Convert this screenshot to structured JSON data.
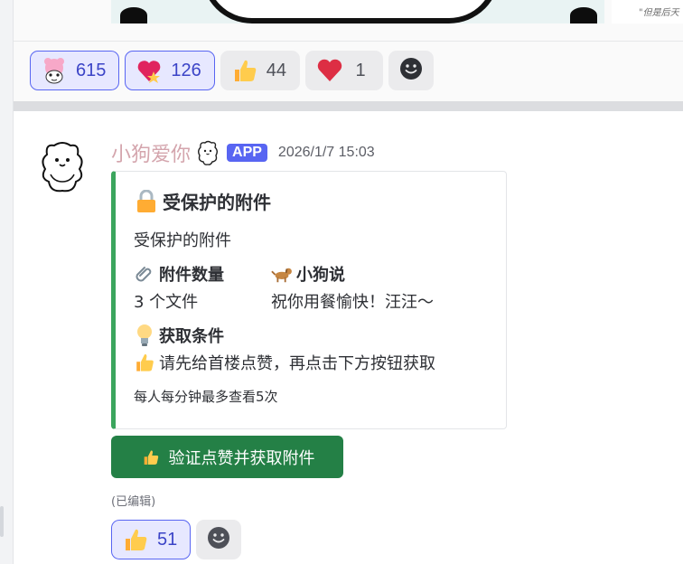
{
  "previous_message": {
    "image_caption": "\"但是后天",
    "reactions": [
      {
        "emoji": "pink-bear-sticker",
        "count": "615",
        "active": true
      },
      {
        "emoji": "heart-with-star",
        "count": "126",
        "active": true
      },
      {
        "emoji": "thumbs-up",
        "count": "44",
        "active": false
      },
      {
        "emoji": "red-heart",
        "count": "1",
        "active": false
      }
    ]
  },
  "message": {
    "username": "小狗爱你",
    "badge": "APP",
    "timestamp": "2026/1/7 15:03",
    "embed": {
      "accent_color": "#3ba55d",
      "title": "受保护的附件",
      "title_icon": "lock-icon",
      "description": "受保护的附件",
      "fields": [
        {
          "icon": "paperclip-icon",
          "name": "附件数量",
          "value": "3 个文件"
        },
        {
          "icon": "dog-icon",
          "name": "小狗说",
          "value": "祝你用餐愉快！汪汪～"
        },
        {
          "icon": "lightbulb-icon",
          "name": "获取条件",
          "value_icon": "thumbs-up-icon",
          "value": "请先给首楼点赞，再点击下方按钮获取"
        }
      ],
      "footer": "每人每分钟最多查看5次"
    },
    "button": {
      "icon": "thumbs-up-icon",
      "label": "验证点赞并获取附件",
      "color": "#248046"
    },
    "edited_label": "(已编辑)",
    "reactions": [
      {
        "emoji": "thumbs-up",
        "count": "51",
        "active": true
      }
    ]
  },
  "colors": {
    "blurple": "#5865f2",
    "username": "#d4a5ad"
  }
}
